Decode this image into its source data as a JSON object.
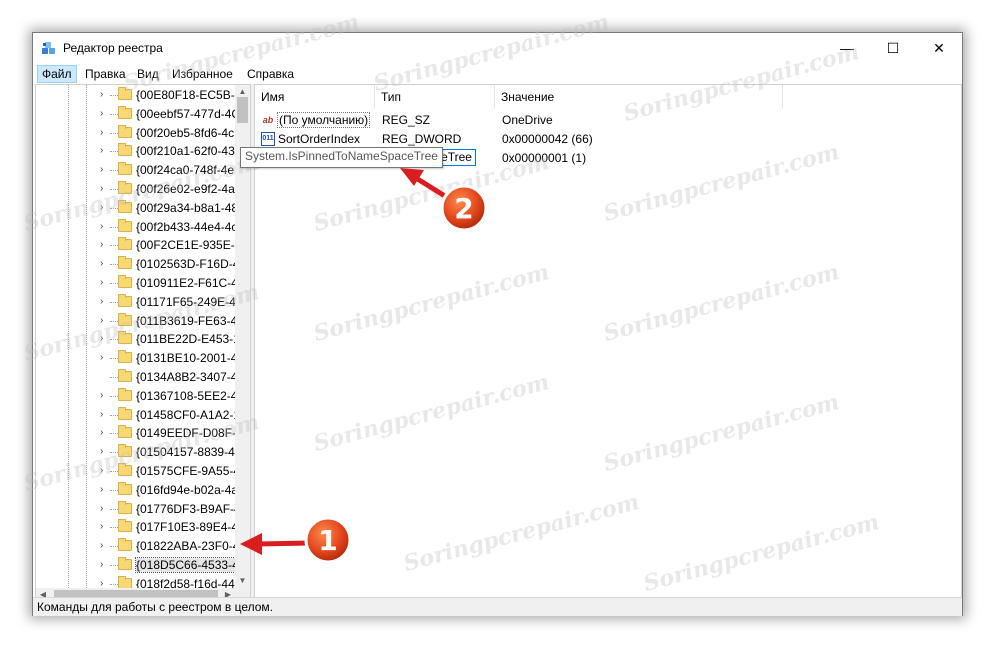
{
  "window": {
    "title": "Редактор реестра"
  },
  "menu": [
    "Файл",
    "Правка",
    "Вид",
    "Избранное",
    "Справка"
  ],
  "tree": {
    "items": [
      "{00E80F18-EC5B-4",
      "{00eebf57-477d-4C",
      "{00f20eb5-8fd6-4c",
      "{00f210a1-62f0-43",
      "{00f24ca0-748f-4e",
      "{00f26e02-e9f2-4a",
      "{00f29a34-b8a1-48",
      "{00f2b433-44e4-4c",
      "{00F2CE1E-935E-4",
      "{0102563D-F16D-4",
      "{010911E2-F61C-4",
      "{01171F65-249E-4E",
      "{011B3619-FE63-48",
      "{011BE22D-E453-1",
      "{0131BE10-2001-4C",
      "{0134A8B2-3407-4",
      "{01367108-5EE2-4E",
      "{01458CF0-A1A2-1",
      "{0149EEDF-D08F-4",
      "{01504157-8839-4E",
      "{01575CFE-9A55-4",
      "{016fd94e-b02a-4a",
      "{01776DF3-B9AF-4",
      "{017F10E3-89E4-49",
      "{01822ABA-23F0-4",
      "{018D5C66-4533-4",
      "{018f2d58-f16d-44"
    ],
    "selected_index": 25
  },
  "list": {
    "columns": [
      "Имя",
      "Тип",
      "Значение"
    ],
    "rows": [
      {
        "name": "(По умолчанию)",
        "type": "REG_SZ",
        "value": "OneDrive",
        "icon": "ab"
      },
      {
        "name": "SortOrderIndex",
        "type": "REG_DWORD",
        "value": "0x00000042 (66)",
        "icon": "011"
      },
      {
        "name": "",
        "type": "",
        "value": "0x00000001 (1)",
        "icon": "011"
      }
    ],
    "edit_value": "System.IsPinnedToNameSpaceTree"
  },
  "tooltip": "System.IsPinnedToNameSpaceTree",
  "status": "Команды для работы с реестром в целом.",
  "watermark": "Soringpcrepair.com",
  "annotations": {
    "badge1": "1",
    "badge2": "2",
    "arrow_color": "#d81e1e"
  }
}
